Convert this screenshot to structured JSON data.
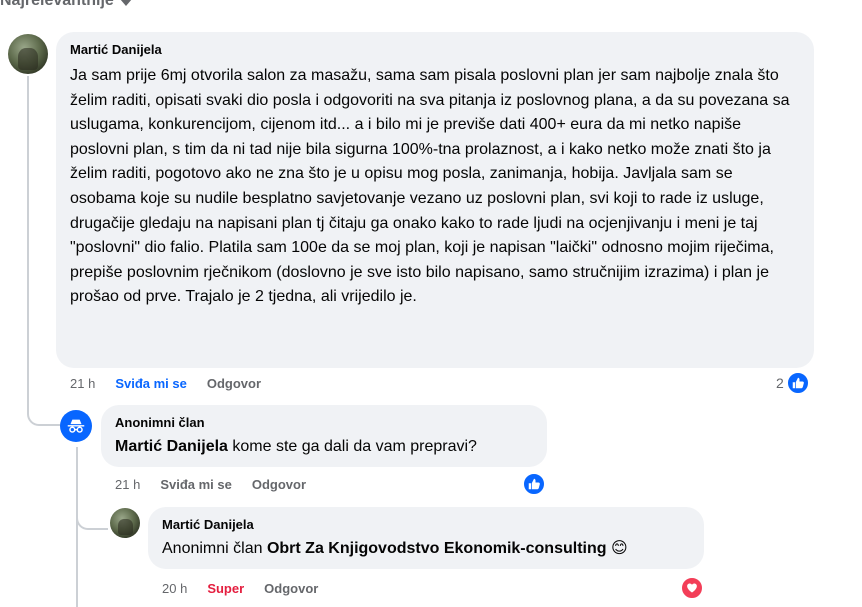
{
  "sort_label": "Najrelevantnije",
  "comments": [
    {
      "author": "Martić Danijela",
      "text": "Ja sam prije 6mj otvorila salon za masažu, sama sam pisala poslovni plan jer sam najbolje znala što želim raditi, opisati svaki dio posla i odgovoriti na sva pitanja iz poslovnog plana, a da su povezana sa uslugama, konkurencijom, cijenom itd... a i bilo mi je previše dati 400+ eura da mi netko napiše poslovni plan, s tim da ni tad nije bila sigurna 100%-tna prolaznost, a i kako netko može znati što ja želim raditi, pogotovo ako ne zna što je u opisu mog posla, zanimanja, hobija. Javljala sam se osobama koje su nudile besplatno savjetovanje vezano uz poslovni plan, svi koji to rade iz usluge, drugačije gledaju na napisani plan tj čitaju ga onako kako to rade ljudi na ocjenjivanju i meni je taj \"poslovni\" dio falio. Platila sam 100e da se moj plan, koji je napisan \"laički\" odnosno mojim riječima, prepiše poslovnim rječnikom (doslovno je sve isto bilo napisano, samo stručnijim izrazima) i plan je prošao od prve. Trajalo je 2 tjedna, ali vrijedilo je.",
      "time": "21 h",
      "like_label": "Sviđa mi se",
      "reply_label": "Odgovor",
      "reaction_count": "2",
      "reaction_icon": "like-icon",
      "like_color": "#0866ff"
    },
    {
      "author": "Anonimni član",
      "mention": "Martić Danijela",
      "text": " kome ste ga dali da vam prepravi?",
      "time": "21 h",
      "like_label": "Sviđa mi se",
      "reply_label": "Odgovor",
      "reaction_count": "",
      "reaction_icon": "like-icon"
    },
    {
      "author": "Martić Danijela",
      "text_prefix": "Anonimni član ",
      "mention": "Obrt Za Knjigovodstvo Ekonomik-consulting",
      "emoji": "😊",
      "time": "20 h",
      "like_label": "Super",
      "reply_label": "Odgovor",
      "reaction_count": "",
      "reaction_icon": "love-icon",
      "like_color": "#e41e3f"
    }
  ]
}
